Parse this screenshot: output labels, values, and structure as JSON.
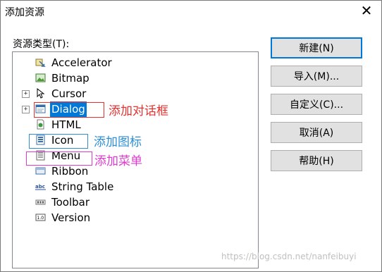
{
  "window": {
    "title": "添加资源",
    "close_glyph": "✕"
  },
  "tree": {
    "label": "资源类型(T):",
    "items": [
      {
        "label": "Accelerator",
        "icon": "accelerator-icon",
        "expander": ""
      },
      {
        "label": "Bitmap",
        "icon": "bitmap-icon",
        "expander": ""
      },
      {
        "label": "Cursor",
        "icon": "cursor-icon",
        "expander": "+"
      },
      {
        "label": "Dialog",
        "icon": "dialog-icon",
        "expander": "+",
        "selected": true
      },
      {
        "label": "HTML",
        "icon": "html-icon",
        "expander": ""
      },
      {
        "label": "Icon",
        "icon": "icon-resource-icon",
        "expander": ""
      },
      {
        "label": "Menu",
        "icon": "menu-icon",
        "expander": ""
      },
      {
        "label": "Ribbon",
        "icon": "ribbon-icon",
        "expander": ""
      },
      {
        "label": "String Table",
        "icon": "string-table-icon",
        "expander": ""
      },
      {
        "label": "Toolbar",
        "icon": "toolbar-icon",
        "expander": ""
      },
      {
        "label": "Version",
        "icon": "version-icon",
        "expander": ""
      }
    ]
  },
  "buttons": {
    "new": "新建(N)",
    "import": "导入(M)...",
    "custom": "自定义(C)...",
    "cancel": "取消(A)",
    "help": "帮助(H)"
  },
  "annotations": {
    "dialog": {
      "text": "添加对话框",
      "color": "#e8312f"
    },
    "icon": {
      "text": "添加图标",
      "color": "#2e8fd6"
    },
    "menu": {
      "text": "添加菜单",
      "color": "#e03ad0"
    }
  },
  "watermark": "https://blog.csdn.net/nanfeibuyi"
}
